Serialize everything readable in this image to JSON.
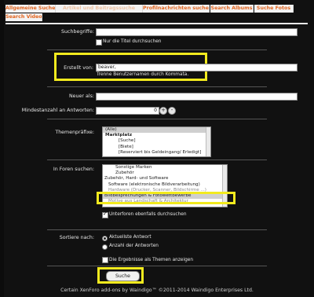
{
  "tabs": [
    {
      "label": "Allgemeine Suche",
      "active": true
    },
    {
      "label": "Artikel und Beitragssuche",
      "active": false
    },
    {
      "label": "Profilnachrichten suchen",
      "active": false
    },
    {
      "label": "Search Albums",
      "active": false
    },
    {
      "label": "Suche Fotos",
      "active": false
    },
    {
      "label": "Search Videos",
      "active": false
    }
  ],
  "form": {
    "keywords_label": "Suchbegriffe:",
    "keywords_value": "",
    "titles_only_label": "Nur die Titel durchsuchen",
    "posted_by_label": "Erstellt von:",
    "posted_by_value": "beaver,",
    "posted_by_hint": "Trenne Benutzernamen durch Kommata.",
    "newer_than_label": "Neuer als:",
    "newer_than_value": "",
    "min_replies_label": "Mindestanzahl an Antworten:",
    "min_replies_value": "0",
    "stepper_plus": "+",
    "stepper_minus": "-",
    "prefixes_label": "Themenpräfixe:",
    "prefixes": [
      {
        "label": "(Alle)",
        "bold": false,
        "selected": true
      },
      {
        "label": "Marktplatz",
        "bold": true,
        "selected": false
      },
      {
        "label": "[Suche]",
        "bold": false,
        "selected": false
      },
      {
        "label": "[Biete]",
        "bold": false,
        "selected": false
      },
      {
        "label": "[Reserviert bis Geldeingang/ Erledigt]",
        "bold": false,
        "selected": false
      }
    ],
    "forums_label": "In Foren suchen:",
    "forums": [
      {
        "label": "Sonstige Marken",
        "indent": 3,
        "selected": false
      },
      {
        "label": "Zubehör",
        "indent": 3,
        "selected": false
      },
      {
        "label": "Zubehör, Hard- und Software",
        "indent": 0,
        "selected": false
      },
      {
        "label": "Software (elektronische Bildverarbeitung)",
        "indent": 1,
        "selected": false
      },
      {
        "label": "Hardware (Drucker, Scanner, Bildschirme ...)",
        "indent": 1,
        "selected": false
      },
      {
        "label": "Bildbesprechungen & Fotowettbewerbe",
        "indent": 0,
        "selected": true
      },
      {
        "label": "Motive aus Landschaft & Architektur",
        "indent": 1,
        "selected": false
      }
    ],
    "child_forums_label": "Unterforen ebenfalls durchsuchen",
    "order_label": "Sortiere nach:",
    "order_newest": "Aktuellste Antwort",
    "order_replies": "Anzahl der Antworten",
    "group_label": "Die Ergebnisse als Themen anzeigen",
    "submit": "Suche"
  },
  "footer": "Certain XenForo add-ons by Waindigo™ ©2011-2014 Waindigo Enterprises Ltd.",
  "colors": {
    "accent": "#e2641e",
    "highlight": "#f2ea1e",
    "background": "#111111"
  }
}
